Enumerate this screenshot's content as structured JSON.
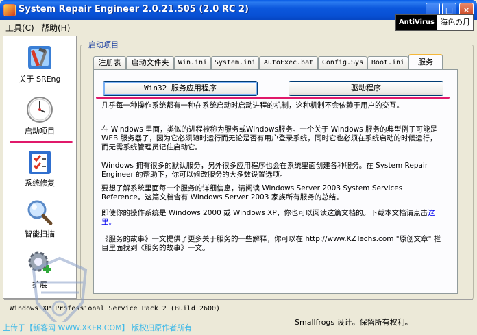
{
  "window": {
    "title": "System Repair Engineer 2.0.21.505 (2.0 RC 2)",
    "controls": {
      "minimize": "_",
      "maximize": "□",
      "close": "✕"
    }
  },
  "menu": [
    "工具(C)",
    "帮助(H)"
  ],
  "badge": {
    "left": "AntiVirus",
    "right": "海色の月"
  },
  "sidebar": {
    "items": [
      {
        "label": "关于 SREng",
        "icon": "tools-icon"
      },
      {
        "label": "启动项目",
        "icon": "clock-icon"
      },
      {
        "label": "系统修复",
        "icon": "checklist-icon"
      },
      {
        "label": "智能扫描",
        "icon": "magnifier-icon"
      },
      {
        "label": "扩展",
        "icon": "gear-plus-icon"
      }
    ]
  },
  "group": {
    "legend": "启动项目"
  },
  "tabs": [
    "注册表",
    "启动文件夹",
    "Win.ini",
    "System.ini",
    "AutoExec.bat",
    "Config.Sys",
    "Boot.ini",
    "服务"
  ],
  "active_tab": "服务",
  "buttons": {
    "win32": "Win32 服务应用程序",
    "driver": "驱动程序"
  },
  "paragraphs": {
    "p1": "几乎每一种操作系统都有一种在系统启动时启动进程的机制，这种机制不会依赖于用户的交互。",
    "p2": "在 Windows 里面，类似的进程被称为服务或Windows服务。一个关于 Windows 服务的典型例子可能是 WEB 服务器了，因为它必须随时运行而无论是否有用户登录系统，同时它也必须在系统启动的时候运行，而无需系统管理员记住启动它。",
    "p3": "Windows 拥有很多的默认服务，另外很多应用程序也会在系统里面创建各种服务。在 System Repair Engineer 的帮助下，你可以修改服务的大多数设置选项。",
    "p4": "要想了解系统里面每一个服务的详细信息，请阅读 Windows Server 2003 System Services Reference。这篇文档含有 Windows Server 2003 家族所有服务的总结。",
    "p5_pre": "即使你的操作系统是 Windows 2000 或 Windows XP，你也可以阅读这篇文档的。下载本文档请点击",
    "p5_link": "这里。",
    "p6": "《服务的故事》一文提供了更多关于服务的一些解释，你可以在 http://www.KZTechs.com \"原创文章\" 栏目里面找到《服务的故事》一文。"
  },
  "status": {
    "os": "Windows XP Professional Service Pack 2 (Build 2600)",
    "copyright": "Smallfrogs 设计。保留所有权利。",
    "watermark": "上传于【新客网 WWW.XKER.COM】 版权归原作者所有"
  },
  "colors": {
    "accent_pink": "#e0196a",
    "titlebar": "#0a5de6",
    "tab_highlight": "#f5b83a"
  }
}
